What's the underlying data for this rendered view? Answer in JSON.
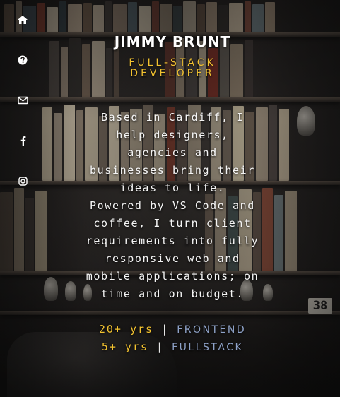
{
  "sidebar": {
    "items": [
      {
        "icon": "home-icon"
      },
      {
        "icon": "question-icon"
      },
      {
        "icon": "envelope-icon"
      },
      {
        "icon": "facebook-icon"
      },
      {
        "icon": "instagram-icon"
      }
    ]
  },
  "hero": {
    "name": "JIMMY BRUNT",
    "role": "FULL-STACK DEVELOPER"
  },
  "bio": {
    "paragraph_1": "Based in Cardiff, I help designers, agencies and businesses bring their ideas to life.",
    "paragraph_2": "Powered by VS Code and coffee, I turn client requirements into fully responsive web and mobile applications; on time and on budget."
  },
  "experience": [
    {
      "years": "20+ yrs",
      "separator": "|",
      "area": "FRONTEND"
    },
    {
      "years": "5+ yrs",
      "separator": "|",
      "area": "FULLSTACK"
    }
  ],
  "background": {
    "shelf_label": "38"
  },
  "colors": {
    "accent": "#f2c230",
    "secondary": "#8fa3c9",
    "text": "#ffffff",
    "icon": "#ffffff"
  }
}
